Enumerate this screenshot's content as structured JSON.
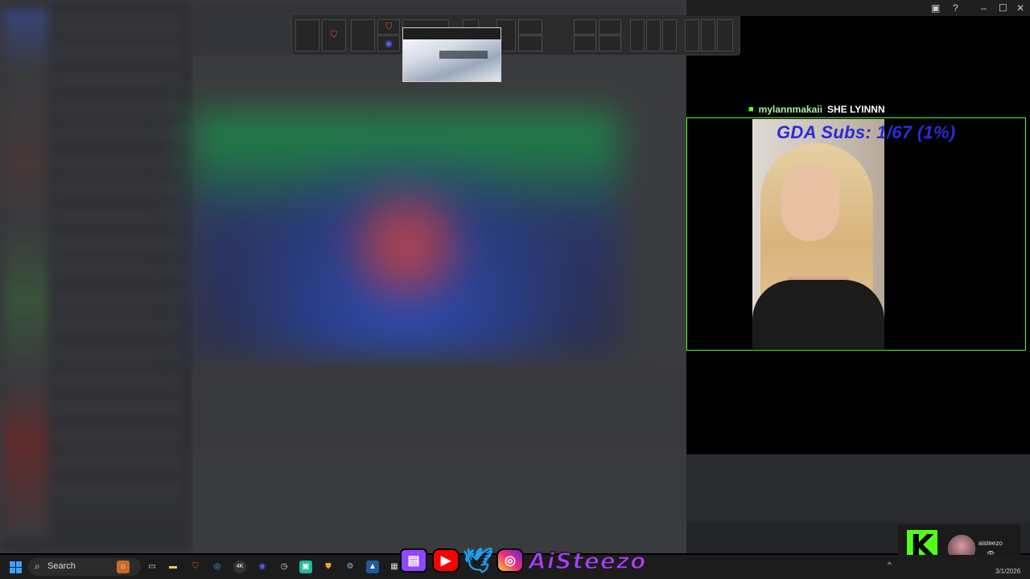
{
  "stream_overlay": {
    "chat": {
      "platform_icon": "kick-icon",
      "username": "mylannmakaii",
      "message": "SHE LYINNN"
    },
    "goal_text": "GDA Subs: 1/67 (1%)",
    "goal": {
      "current": 1,
      "target": 67,
      "percent": 1
    },
    "social_handle": "AiSteezo",
    "social_icons": [
      "twitch-icon",
      "youtube-icon",
      "twitter-icon",
      "instagram-icon"
    ],
    "kick_card": {
      "username": "aisteezo",
      "logo": "K",
      "viewer_icon": "eye-icon",
      "viewer_glyph": "👁"
    }
  },
  "task_view": {
    "pinned_icons": [
      "brave-icon",
      "brave-icon",
      "discord-icon"
    ]
  },
  "window_chrome": {
    "icons": [
      "inbox-icon",
      "help-icon",
      "minimize-icon",
      "maximize-icon",
      "close-icon"
    ],
    "minimize": "–",
    "maximize": "☐",
    "close": "✕",
    "help": "?"
  },
  "taskbar": {
    "search_placeholder": "Search",
    "apps": [
      "widgets-icon",
      "task-view-icon",
      "file-explorer-icon",
      "brave-icon",
      "edge-icon",
      "4k-downloader-icon",
      "discord-icon",
      "clock-icon",
      "app-icon",
      "shield-icon",
      "steam-icon",
      "app-icon",
      "app-icon"
    ],
    "tray_chevron": "^",
    "date": "3/1/2026"
  },
  "colors": {
    "kick_green": "#53fc18",
    "goal_text": "#2b2bd8",
    "brand_purple": "#b03cff",
    "windows_blue": "#3aa0ff"
  }
}
